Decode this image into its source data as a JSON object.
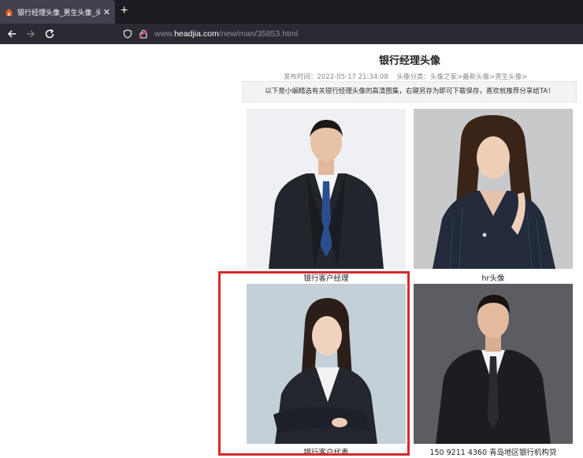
{
  "browser": {
    "tab_title": "银行经理头像_男生头像_头像之",
    "url_prefix": "www.",
    "url_domain": "headjia.com",
    "url_path": "/new/man/35853.html",
    "new_tab_label": "+",
    "close_label": "✕"
  },
  "article": {
    "title": "银行经理头像",
    "publish_time": "发布时间：2022-05-17 21:34:08",
    "category": "头像分类：头像之家>最新头像>男生头像>",
    "intro": "以下是小编精选有关银行经理头像的高清图集，右键另存为即可下载保存，喜欢就推荐分享给TA！"
  },
  "gallery": [
    {
      "caption": "银行客户经理"
    },
    {
      "caption": "hr头像"
    },
    {
      "caption": "银行客户代表"
    },
    {
      "caption": "150 9211 4360 青岛地区银行机构贷"
    }
  ],
  "colors": {
    "tab_bg": "#42414d",
    "toolbar_bg": "#2b2a33",
    "highlight": "#d42a2a"
  }
}
